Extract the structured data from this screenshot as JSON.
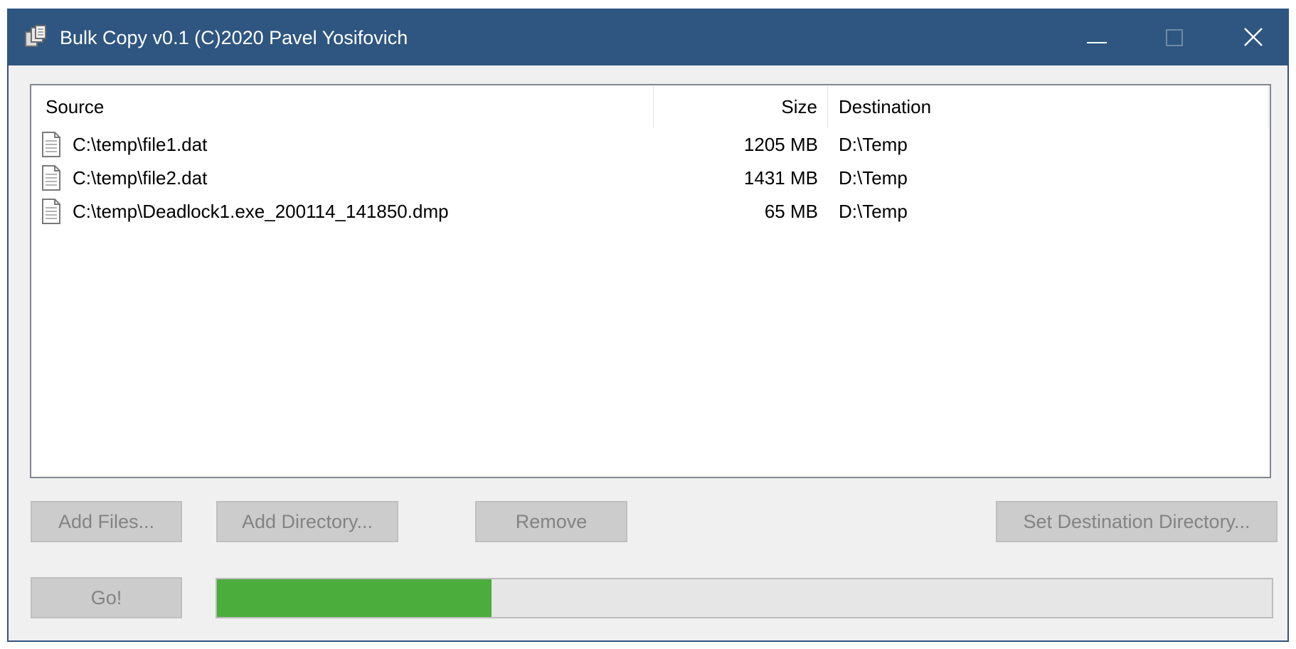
{
  "window": {
    "title": "Bulk Copy v0.1 (C)2020 Pavel Yosifovich",
    "icon": "copy-app-icon",
    "controls": [
      "minimize-icon",
      "maximize-icon",
      "close-icon"
    ]
  },
  "listview": {
    "columns": [
      "Source",
      "Size",
      "Destination"
    ],
    "rows": [
      {
        "source": "C:\\temp\\file1.dat",
        "size": "1205 MB",
        "destination": "D:\\Temp",
        "icon": "document-icon"
      },
      {
        "source": "C:\\temp\\file2.dat",
        "size": "1431 MB",
        "destination": "D:\\Temp",
        "icon": "document-icon"
      },
      {
        "source": "C:\\temp\\Deadlock1.exe_200114_141850.dmp",
        "size": "65 MB",
        "destination": "D:\\Temp",
        "icon": "document-icon"
      }
    ]
  },
  "buttons": {
    "add_files": "Add Files...",
    "add_directory": "Add Directory...",
    "remove": "Remove",
    "set_destination": "Set Destination Directory...",
    "go": "Go!"
  },
  "progress": {
    "fraction": 0.26
  },
  "colors": {
    "titlebar": "#2e5680",
    "progress_fill": "#4bad3c",
    "disabled_button": "#cccccc",
    "disabled_text": "#838383"
  }
}
